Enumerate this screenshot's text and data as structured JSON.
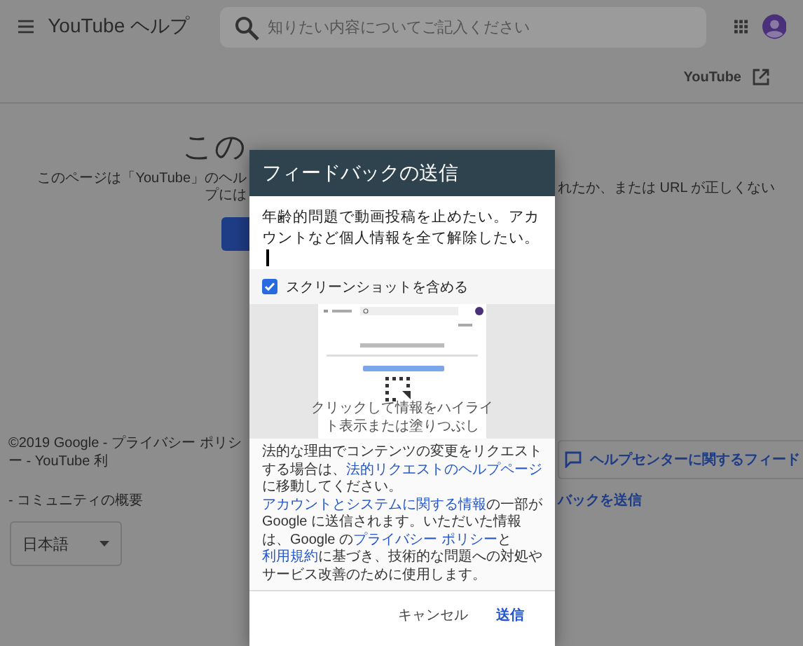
{
  "header": {
    "title": "YouTube ヘルプ",
    "search": {
      "placeholder": "知りたい内容についてご記入ください"
    }
  },
  "subheader": {
    "link": "YouTube"
  },
  "page": {
    "heading": "この",
    "description_left": "このページは「YouTube」のヘルプには",
    "description_right": "れたか、または URL が正しくない",
    "footer_left": "©2019 Google - プライバシー ポリシー - YouTube 利",
    "footer_link": "- コミュニティの概要",
    "language": "日本語",
    "feedback_card": "ヘルプセンターに関するフィード",
    "feedback_link": "バックを送信"
  },
  "dialog": {
    "title": "フィードバックの送信",
    "message": "年齢的問題で動画投稿を止めたい。アカウントなど個人情報を全て解除したい。",
    "include_screenshot": {
      "label": "スクリーンショットを含める",
      "checked": true
    },
    "screenshot_hint": "クリックして情報をハイライト表示または塗りつぶし",
    "legal": [
      {
        "text": "法的な理由でコンテンツの変更をリクエストする場合は、",
        "link": false
      },
      {
        "text": "法的リクエストのヘルプページ",
        "link": true
      },
      {
        "text": "に移動してください。",
        "link": false
      },
      {
        "text": "アカウントとシステムに関する情報",
        "link": true
      },
      {
        "text": "の一部が Google に送信されます。いただいた情報は、Google の",
        "link": false
      },
      {
        "text": "プライバシー ポリシー",
        "link": true
      },
      {
        "text": "と",
        "link": false
      },
      {
        "text": "利用規約",
        "link": true
      },
      {
        "text": "に基づき、技術的な問題への対処やサービス改善のために使用します。",
        "link": false
      }
    ],
    "buttons": [
      {
        "label": "キャンセル",
        "kind": "secondary"
      },
      {
        "label": "送信",
        "kind": "primary"
      }
    ]
  }
}
